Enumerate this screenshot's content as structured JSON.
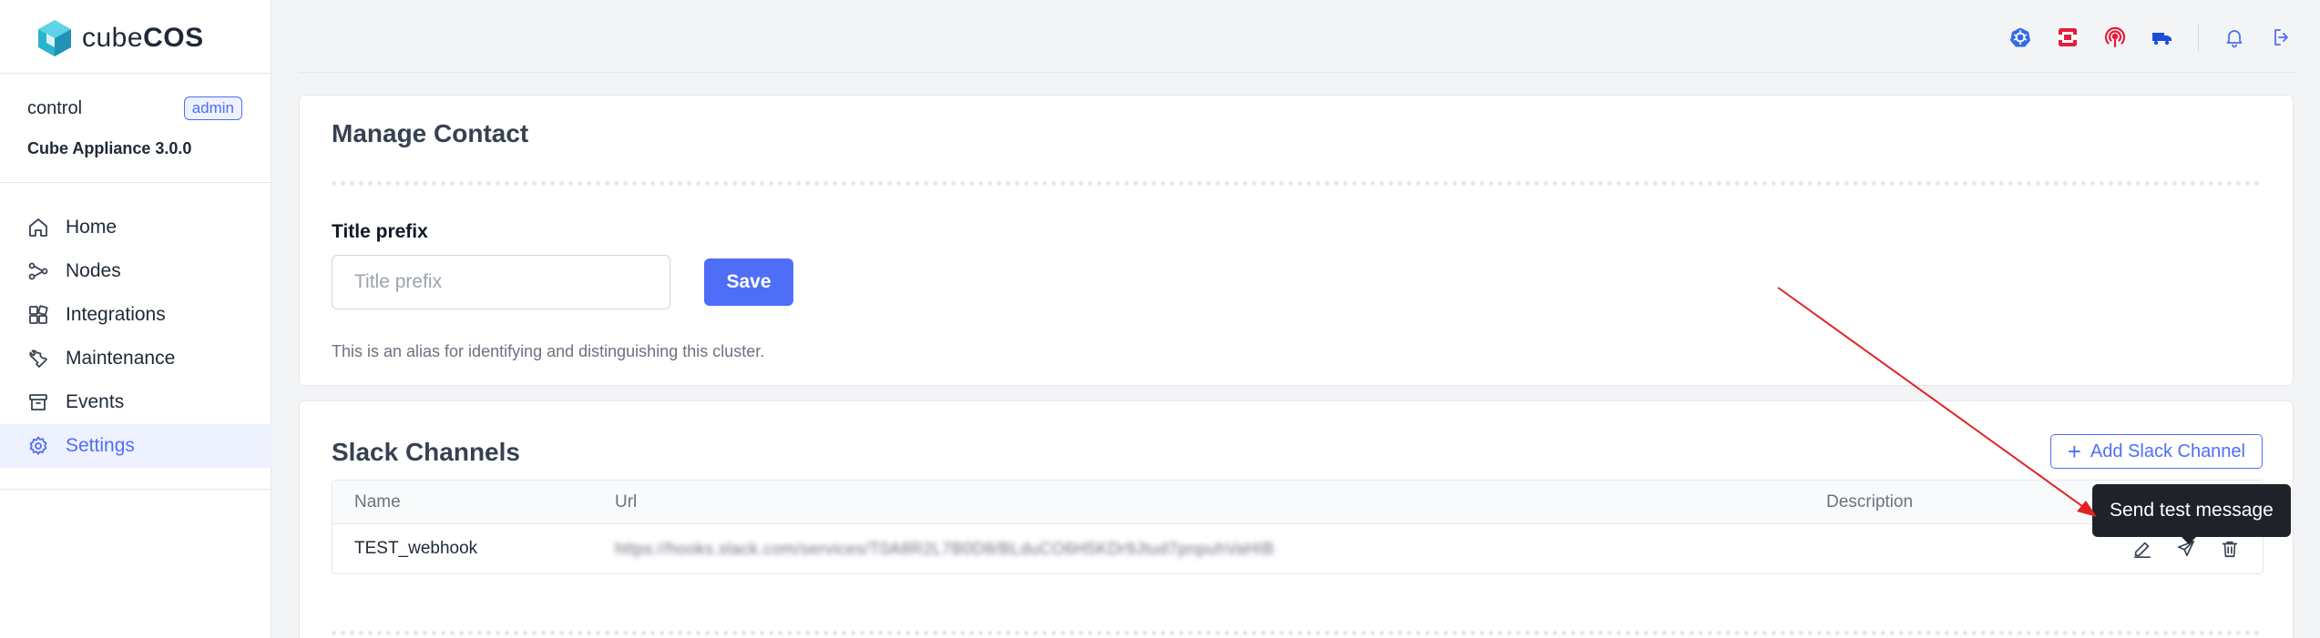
{
  "brand": {
    "prefix": "cube",
    "suffix": "COS"
  },
  "user": {
    "name": "control",
    "role": "admin",
    "appliance": "Cube Appliance 3.0.0"
  },
  "sidebar": {
    "items": [
      {
        "label": "Home",
        "icon": "home-icon",
        "active": false
      },
      {
        "label": "Nodes",
        "icon": "nodes-icon",
        "active": false
      },
      {
        "label": "Integrations",
        "icon": "integrations-icon",
        "active": false
      },
      {
        "label": "Maintenance",
        "icon": "wrench-icon",
        "active": false
      },
      {
        "label": "Events",
        "icon": "archive-icon",
        "active": false
      },
      {
        "label": "Settings",
        "icon": "gear-icon",
        "active": true
      }
    ]
  },
  "topbar": {
    "icons": [
      "kubernetes-icon",
      "openstack-icon",
      "podcast-icon",
      "truck-icon",
      "bell-icon",
      "logout-icon"
    ]
  },
  "contact": {
    "title": "Manage Contact",
    "field_label": "Title prefix",
    "input_value": "",
    "input_placeholder": "Title prefix",
    "save_label": "Save",
    "helper": "This is an alias for identifying and distinguishing this cluster."
  },
  "slack": {
    "title": "Slack Channels",
    "add_label": "Add Slack Channel",
    "columns": {
      "name": "Name",
      "url": "Url",
      "description": "Description"
    },
    "rows": [
      {
        "name": "TEST_webhook",
        "url": "https://hooks.slack.com/services/T0A8R2L7B0D8/BLduCO6H5KDr9Jtud7pnpuhVaHIB",
        "description": ""
      }
    ],
    "tooltip": "Send test message"
  },
  "colors": {
    "accent": "#4f6ef7",
    "annotation": "#e02424",
    "tooltip_bg": "#1f2329"
  }
}
